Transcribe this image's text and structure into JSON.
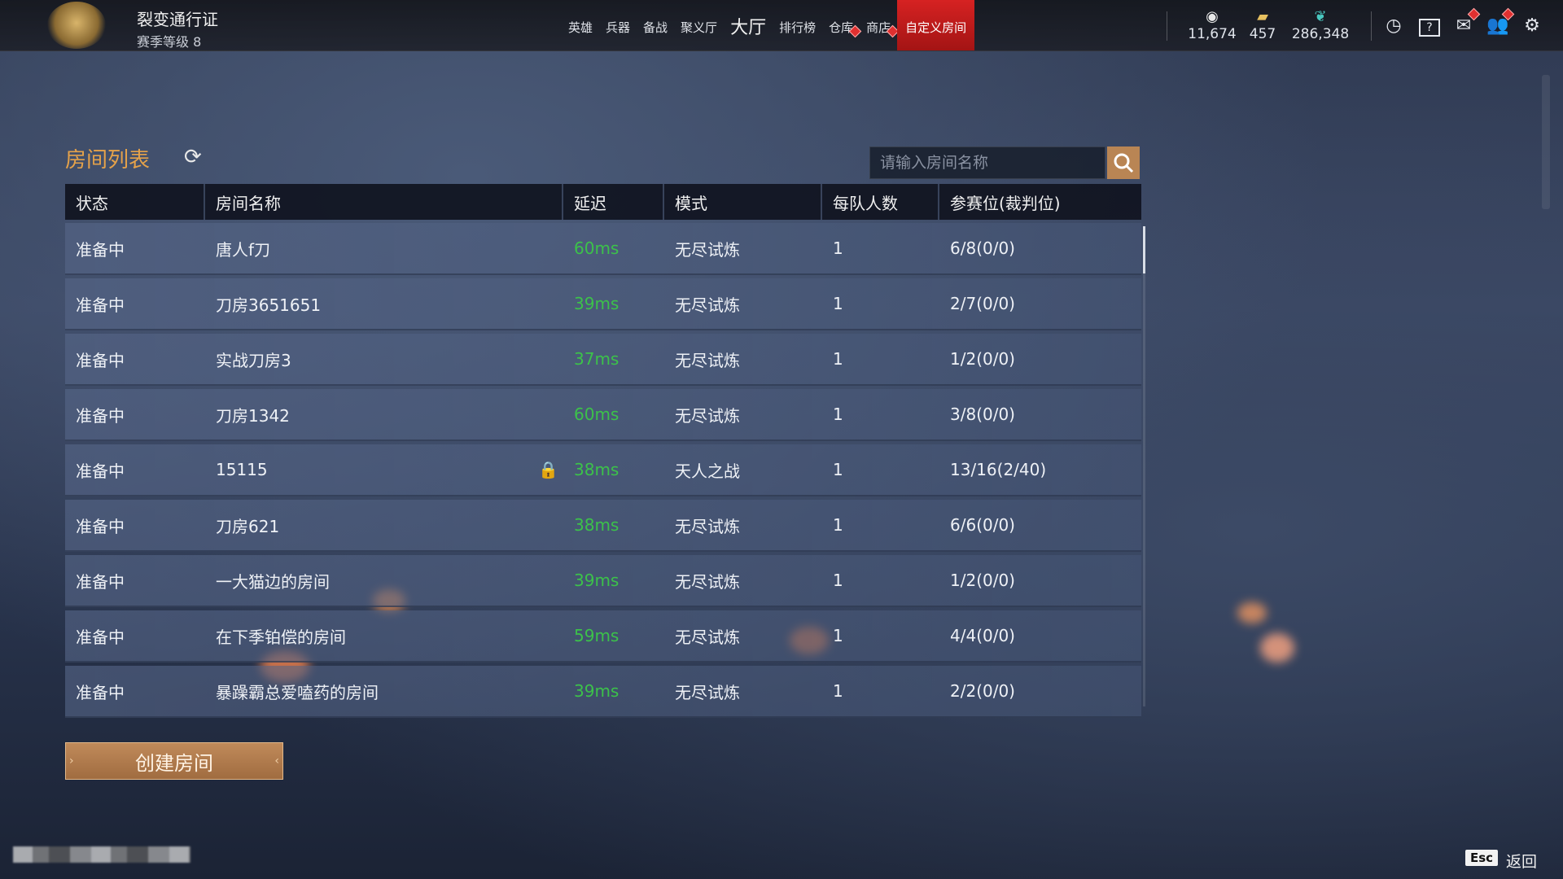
{
  "header": {
    "pass_title": "裂变通行证",
    "pass_level": "赛季等级 8",
    "nav": [
      {
        "label": "英雄"
      },
      {
        "label": "兵器"
      },
      {
        "label": "备战"
      },
      {
        "label": "聚义厅"
      },
      {
        "label": "大厅"
      },
      {
        "label": "排行榜"
      },
      {
        "label": "仓库"
      },
      {
        "label": "商店"
      },
      {
        "label": "自定义房间"
      }
    ],
    "currencies": [
      {
        "icon": "gold-coin-icon",
        "value": "11,674"
      },
      {
        "icon": "ticket-icon",
        "value": "457"
      },
      {
        "icon": "feather-icon",
        "value": "286,348"
      }
    ]
  },
  "room_list": {
    "title": "房间列表",
    "search_placeholder": "请输入房间名称",
    "columns": [
      "状态",
      "房间名称",
      "延迟",
      "模式",
      "每队人数",
      "参赛位(裁判位)"
    ],
    "rows": [
      {
        "status": "准备中",
        "name": "唐人f刀",
        "locked": false,
        "ping": "60ms",
        "mode": "无尽试炼",
        "team_size": "1",
        "slots": "6/8(0/0)"
      },
      {
        "status": "准备中",
        "name": "刀房3651651",
        "locked": false,
        "ping": "39ms",
        "mode": "无尽试炼",
        "team_size": "1",
        "slots": "2/7(0/0)"
      },
      {
        "status": "准备中",
        "name": "实战刀房3",
        "locked": false,
        "ping": "37ms",
        "mode": "无尽试炼",
        "team_size": "1",
        "slots": "1/2(0/0)"
      },
      {
        "status": "准备中",
        "name": "刀房1342",
        "locked": false,
        "ping": "60ms",
        "mode": "无尽试炼",
        "team_size": "1",
        "slots": "3/8(0/0)"
      },
      {
        "status": "准备中",
        "name": "15115",
        "locked": true,
        "ping": "38ms",
        "mode": "天人之战",
        "team_size": "1",
        "slots": "13/16(2/40)"
      },
      {
        "status": "准备中",
        "name": "刀房621",
        "locked": false,
        "ping": "38ms",
        "mode": "无尽试炼",
        "team_size": "1",
        "slots": "6/6(0/0)"
      },
      {
        "status": "准备中",
        "name": "一大猫边的房间",
        "locked": false,
        "ping": "39ms",
        "mode": "无尽试炼",
        "team_size": "1",
        "slots": "1/2(0/0)"
      },
      {
        "status": "准备中",
        "name": "在下季铂偿的房间",
        "locked": false,
        "ping": "59ms",
        "mode": "无尽试炼",
        "team_size": "1",
        "slots": "4/4(0/0)"
      },
      {
        "status": "准备中",
        "name": "暴躁霸总爱嗑药的房间",
        "locked": false,
        "ping": "39ms",
        "mode": "无尽试炼",
        "team_size": "1",
        "slots": "2/2(0/0)"
      }
    ],
    "create_button": "创建房间"
  },
  "footer": {
    "esc_key": "Esc",
    "back_label": "返回"
  },
  "colors": {
    "accent_title": "#e5a24a",
    "ping_good": "#3cc24a",
    "nav_active": "#d62222",
    "button": "#b98554"
  }
}
